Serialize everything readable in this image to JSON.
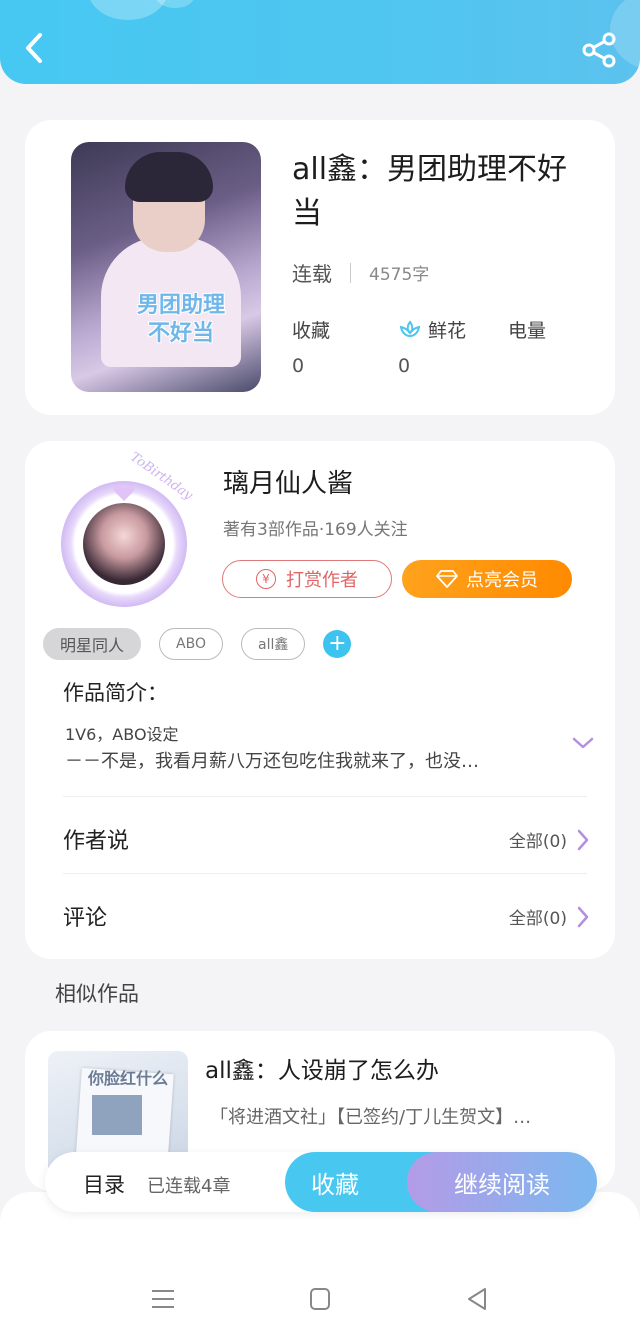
{
  "book": {
    "title": "all鑫：男团助理不好当",
    "status": "连载",
    "word_count": "4575字",
    "cover_text_line1": "男团助理",
    "cover_text_line2": "不好当",
    "stats": [
      {
        "label": "收藏",
        "value": "0"
      },
      {
        "label": "鲜花",
        "value": "0"
      },
      {
        "label": "电量",
        "value": ""
      }
    ]
  },
  "author": {
    "name": "璃月仙人酱",
    "meta": "著有3部作品·169人关注",
    "tip_label": "打赏作者",
    "vip_label": "点亮会员",
    "avatar_decor_text": "ToBirthday"
  },
  "tags": [
    "明星同人",
    "ABO",
    "all鑫"
  ],
  "intro": {
    "heading": "作品简介：",
    "line1": "1V6，ABO设定",
    "line2": "－－不是，我看月薪八万还包吃住我就来了，也没…"
  },
  "rows": {
    "author_says": {
      "label": "作者说",
      "right": "全部(0)"
    },
    "comments": {
      "label": "评论",
      "right": "全部(0)"
    }
  },
  "similar": {
    "heading": "相似作品",
    "items": [
      {
        "title": "all鑫：人设崩了怎么办",
        "desc": "「将进酒文社」【已签约/丁儿生贺文】…",
        "cover_text": "你脸红什么"
      }
    ]
  },
  "bottom_bar": {
    "toc_label": "目录",
    "chapters": "已连载4章",
    "fav_label": "收藏",
    "read_label": "继续阅读"
  },
  "colors": {
    "accent": "#48c8f0",
    "vip_orange": "#ff9a10",
    "tip_red": "#e06464",
    "chevron_purple": "#b58ee0"
  }
}
